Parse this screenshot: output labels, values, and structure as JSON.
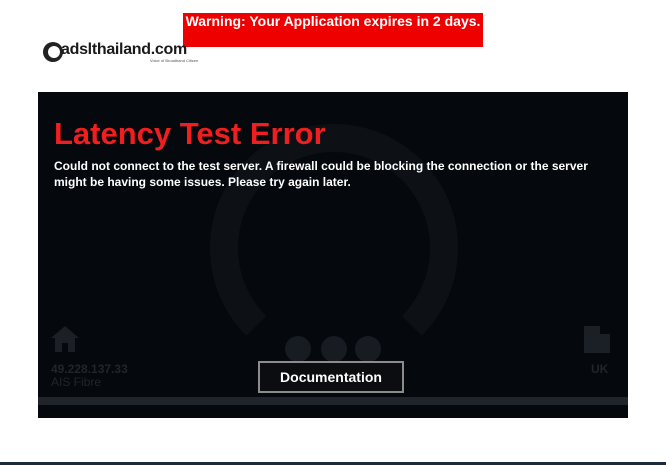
{
  "warning": {
    "text": "Warning: Your Application expires in 2 days."
  },
  "logo": {
    "text": "adslthailand.com",
    "tagline": "Voice of Broadband Citizen"
  },
  "error": {
    "title": "Latency Test Error",
    "message": "Could not connect to the test server. A firewall could be blocking the connection or the server might be having some issues. Please try again later."
  },
  "client": {
    "ip": "49.228.137.33",
    "isp": "AIS Fibre",
    "icon": "home-icon"
  },
  "server": {
    "country": "UK",
    "icon": "building-icon"
  },
  "documentation_button": {
    "label": "Documentation"
  },
  "colors": {
    "accent": "#ef1f1f",
    "warning_bg": "#ef0000",
    "panel_bg": "#05080c"
  }
}
